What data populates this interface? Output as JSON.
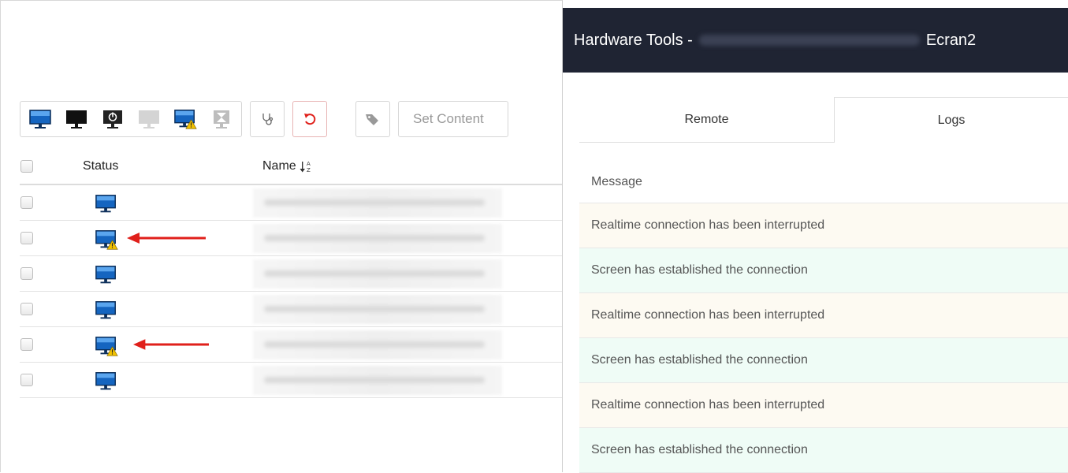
{
  "toolbar": {
    "set_content_label": "Set Content"
  },
  "table": {
    "columns": {
      "status": "Status",
      "name": "Name"
    },
    "rows": [
      {
        "status": "online",
        "warning": false,
        "arrow": false
      },
      {
        "status": "online",
        "warning": true,
        "arrow": true
      },
      {
        "status": "online",
        "warning": false,
        "arrow": false
      },
      {
        "status": "online",
        "warning": false,
        "arrow": false
      },
      {
        "status": "online",
        "warning": true,
        "arrow": true
      },
      {
        "status": "online",
        "warning": false,
        "arrow": false
      }
    ]
  },
  "hardware": {
    "title_prefix": "Hardware Tools -",
    "title_suffix": "Ecran2",
    "tabs": {
      "remote": "Remote",
      "logs": "Logs"
    },
    "message_header": "Message",
    "logs": [
      {
        "text": "Realtime connection has been interrupted",
        "kind": "warn"
      },
      {
        "text": "Screen has established the connection",
        "kind": "ok"
      },
      {
        "text": "Realtime connection has been interrupted",
        "kind": "warn"
      },
      {
        "text": "Screen has established the connection",
        "kind": "ok"
      },
      {
        "text": "Realtime connection has been interrupted",
        "kind": "warn"
      },
      {
        "text": "Screen has established the connection",
        "kind": "ok"
      }
    ]
  },
  "colors": {
    "header_bg": "#1f2433",
    "monitor_blue": "#1565c0",
    "warning_yellow": "#f2c200",
    "arrow_red": "#e0201b",
    "warn_row": "#fdfaf2",
    "ok_row": "#effcf6"
  },
  "icons": {
    "toolbar": [
      "monitor-on-icon",
      "monitor-black-icon",
      "monitor-power-icon",
      "monitor-disabled-icon",
      "monitor-warning-icon",
      "monitor-hourglass-icon",
      "stethoscope-icon",
      "restart-icon",
      "tag-icon"
    ]
  }
}
